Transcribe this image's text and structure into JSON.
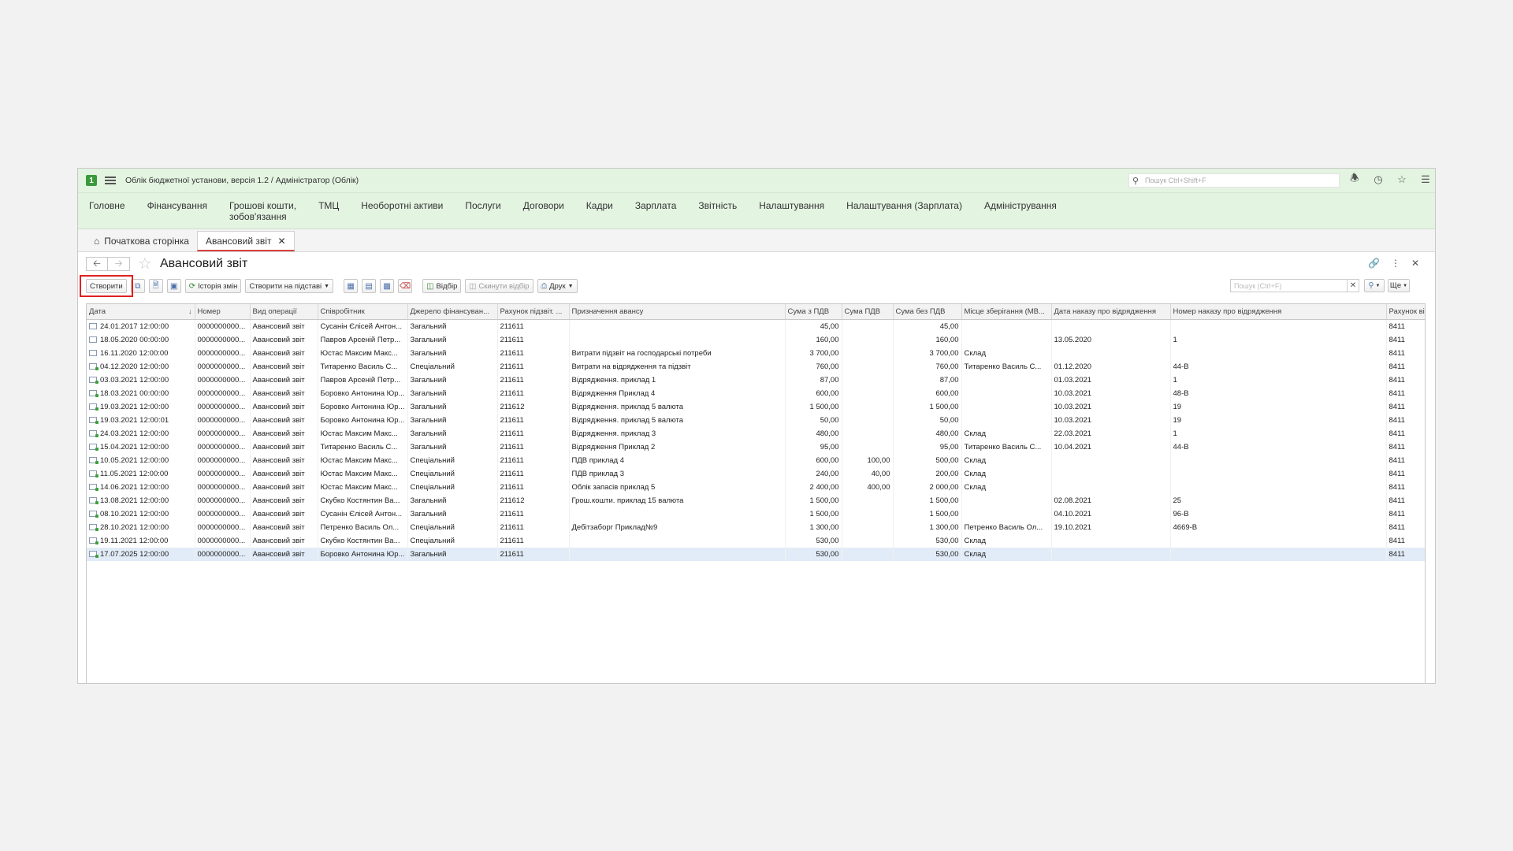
{
  "app": {
    "title": "Облік бюджетної установи, версія 1.2 / Адміністратор  (Облік)",
    "global_search_placeholder": "Пошук Ctrl+Shift+F"
  },
  "menu": [
    "Головне",
    "Фінансування",
    "Грошові кошти,\nзобов'язання",
    "ТМЦ",
    "Необоротні активи",
    "Послуги",
    "Договори",
    "Кадри",
    "Зарплата",
    "Звітність",
    "Налаштування",
    "Налаштування (Зарплата)",
    "Адміністрування"
  ],
  "tabs": {
    "home": "Початкова сторінка",
    "active": "Авансовий звіт"
  },
  "form": {
    "title": "Авансовий звіт"
  },
  "toolbar": {
    "create": "Створити",
    "history": "Історія змін",
    "create_based": "Створити на підставі",
    "filter": "Відбір",
    "reset_filter": "Скинути відбір",
    "print": "Друк",
    "search_placeholder": "Пошук (Ctrl+F)",
    "more": "Ще"
  },
  "table": {
    "columns": [
      "Дата",
      "Номер",
      "Вид операції",
      "Співробітник",
      "Джерело фінансуван...",
      "Рахунок підзвіт. ...",
      "Призначення авансу",
      "Сума з ПДВ",
      "Сума ПДВ",
      "Сума без ПДВ",
      "Місце зберігання (МВ...",
      "Дата наказу про відрядження",
      "Номер наказу про відрядження",
      "Рахунок ві"
    ],
    "rows": [
      {
        "posted": false,
        "c": [
          "24.01.2017 12:00:00",
          "0000000000...",
          "Авансовий звіт",
          "Сусанін Єлісей Антон...",
          "Загальний",
          "211611",
          "",
          "45,00",
          "",
          "45,00",
          "",
          "",
          "",
          "8411"
        ]
      },
      {
        "posted": false,
        "c": [
          "18.05.2020 00:00:00",
          "0000000000...",
          "Авансовий звіт",
          "Павров Арсеній Петр...",
          "Загальний",
          "211611",
          "",
          "160,00",
          "",
          "160,00",
          "",
          "13.05.2020",
          "1",
          "8411"
        ]
      },
      {
        "posted": false,
        "c": [
          "16.11.2020 12:00:00",
          "0000000000...",
          "Авансовий звіт",
          "Юстас Максим Макс...",
          "Загальний",
          "211611",
          "Витрати підзвіт на господарські потреби",
          "3 700,00",
          "",
          "3 700,00",
          "Склад",
          "",
          "",
          "8411"
        ]
      },
      {
        "posted": true,
        "c": [
          "04.12.2020 12:00:00",
          "0000000000...",
          "Авансовий звіт",
          "Титаренко Василь С...",
          "Спеціальний",
          "211611",
          "Витрати на відрядження та підзвіт",
          "760,00",
          "",
          "760,00",
          "Титаренко Василь С...",
          "01.12.2020",
          "44-В",
          "8411"
        ]
      },
      {
        "posted": true,
        "c": [
          "03.03.2021 12:00:00",
          "0000000000...",
          "Авансовий звіт",
          "Павров Арсеній Петр...",
          "Загальний",
          "211611",
          "Відрядження. приклад 1",
          "87,00",
          "",
          "87,00",
          "",
          "01.03.2021",
          "1",
          "8411"
        ]
      },
      {
        "posted": true,
        "c": [
          "18.03.2021 00:00:00",
          "0000000000...",
          "Авансовий звіт",
          "Боровко Антонина Юр...",
          "Загальний",
          "211611",
          "Відрядження Приклад 4",
          "600,00",
          "",
          "600,00",
          "",
          "10.03.2021",
          "48-В",
          "8411"
        ]
      },
      {
        "posted": true,
        "c": [
          "19.03.2021 12:00:00",
          "0000000000...",
          "Авансовий звіт",
          "Боровко Антонина Юр...",
          "Загальний",
          "211612",
          "Відрядження. приклад 5 валюта",
          "1 500,00",
          "",
          "1 500,00",
          "",
          "10.03.2021",
          "19",
          "8411"
        ]
      },
      {
        "posted": true,
        "c": [
          "19.03.2021 12:00:01",
          "0000000000...",
          "Авансовий звіт",
          "Боровко Антонина Юр...",
          "Загальний",
          "211611",
          "Відрядження. приклад 5 валюта",
          "50,00",
          "",
          "50,00",
          "",
          "10.03.2021",
          "19",
          "8411"
        ]
      },
      {
        "posted": true,
        "c": [
          "24.03.2021 12:00:00",
          "0000000000...",
          "Авансовий звіт",
          "Юстас Максим Макс...",
          "Загальний",
          "211611",
          "Відрядження. приклад 3",
          "480,00",
          "",
          "480,00",
          "Склад",
          "22.03.2021",
          "1",
          "8411"
        ]
      },
      {
        "posted": true,
        "c": [
          "15.04.2021 12:00:00",
          "0000000000...",
          "Авансовий звіт",
          "Титаренко Василь С...",
          "Загальний",
          "211611",
          "Відрядження Приклад 2",
          "95,00",
          "",
          "95,00",
          "Титаренко Василь С...",
          "10.04.2021",
          "44-В",
          "8411"
        ]
      },
      {
        "posted": true,
        "c": [
          "10.05.2021 12:00:00",
          "0000000000...",
          "Авансовий звіт",
          "Юстас Максим Макс...",
          "Спеціальний",
          "211611",
          "ПДВ приклад 4",
          "600,00",
          "100,00",
          "500,00",
          "Склад",
          "",
          "",
          "8411"
        ]
      },
      {
        "posted": true,
        "c": [
          "11.05.2021 12:00:00",
          "0000000000...",
          "Авансовий звіт",
          "Юстас Максим Макс...",
          "Спеціальний",
          "211611",
          "ПДВ приклад 3",
          "240,00",
          "40,00",
          "200,00",
          "Склад",
          "",
          "",
          "8411"
        ]
      },
      {
        "posted": true,
        "c": [
          "14.06.2021 12:00:00",
          "0000000000...",
          "Авансовий звіт",
          "Юстас Максим Макс...",
          "Спеціальний",
          "211611",
          "Облік запасів приклад 5",
          "2 400,00",
          "400,00",
          "2 000,00",
          "Склад",
          "",
          "",
          "8411"
        ]
      },
      {
        "posted": true,
        "c": [
          "13.08.2021 12:00:00",
          "0000000000...",
          "Авансовий звіт",
          "Скубко Костянтин Ва...",
          "Загальний",
          "211612",
          "Грош.кошти. приклад 15 валюта",
          "1 500,00",
          "",
          "1 500,00",
          "",
          "02.08.2021",
          "25",
          "8411"
        ]
      },
      {
        "posted": true,
        "c": [
          "08.10.2021 12:00:00",
          "0000000000...",
          "Авансовий звіт",
          "Сусанін Єлісей Антон...",
          "Загальний",
          "211611",
          "",
          "1 500,00",
          "",
          "1 500,00",
          "",
          "04.10.2021",
          "96-В",
          "8411"
        ]
      },
      {
        "posted": true,
        "c": [
          "28.10.2021 12:00:00",
          "0000000000...",
          "Авансовий звіт",
          "Петренко Василь Ол...",
          "Спеціальний",
          "211611",
          "Дебітзаборг Приклад№9",
          "1 300,00",
          "",
          "1 300,00",
          "Петренко Василь Ол...",
          "19.10.2021",
          "4669-В",
          "8411"
        ]
      },
      {
        "posted": true,
        "c": [
          "19.11.2021 12:00:00",
          "0000000000...",
          "Авансовий звіт",
          "Скубко Костянтин Ва...",
          "Спеціальний",
          "211611",
          "",
          "530,00",
          "",
          "530,00",
          "Склад",
          "",
          "",
          "8411"
        ]
      },
      {
        "posted": true,
        "selected": true,
        "c": [
          "17.07.2025 12:00:00",
          "0000000000...",
          "Авансовий звіт",
          "Боровко Антонина Юр...",
          "Загальний",
          "211611",
          "",
          "530,00",
          "",
          "530,00",
          "Склад",
          "",
          "",
          "8411"
        ]
      }
    ]
  }
}
